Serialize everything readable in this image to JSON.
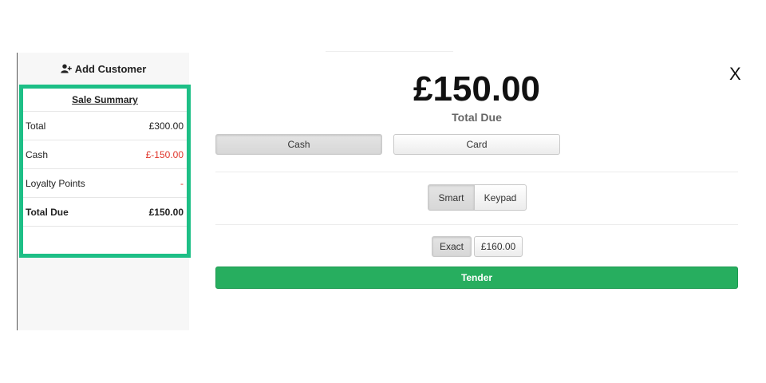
{
  "sidebar": {
    "add_customer_label": "Add Customer",
    "summary": {
      "title": "Sale Summary",
      "rows": [
        {
          "label": "Total",
          "value": "£300.00"
        },
        {
          "label": "Cash",
          "value": "£-150.00"
        },
        {
          "label": "Loyalty Points",
          "value": "-"
        },
        {
          "label": "Total Due",
          "value": "£150.00"
        }
      ]
    }
  },
  "main": {
    "amount": "£150.00",
    "amount_label": "Total Due",
    "payment_methods": [
      "Cash",
      "Card"
    ],
    "modes": [
      "Smart",
      "Keypad"
    ],
    "quick_amounts": [
      "Exact",
      "£160.00"
    ],
    "tender_label": "Tender",
    "close_label": "X"
  },
  "colors": {
    "summary_border": "#1dbf86",
    "tender": "#27ae5f",
    "negative": "#e0362b"
  }
}
